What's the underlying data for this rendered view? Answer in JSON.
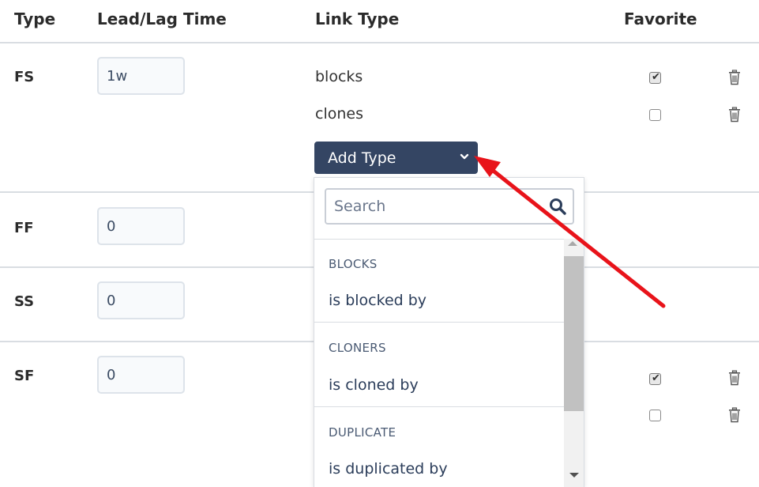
{
  "headers": {
    "type": "Type",
    "lead_lag": "Lead/Lag Time",
    "link_type": "Link Type",
    "favorite": "Favorite"
  },
  "rows": [
    {
      "type": "FS",
      "lead_lag": "1w"
    },
    {
      "type": "FF",
      "lead_lag": "0"
    },
    {
      "type": "SS",
      "lead_lag": "0"
    },
    {
      "type": "SF",
      "lead_lag": "0"
    }
  ],
  "fs_links": [
    {
      "label": "blocks",
      "favorite": true
    },
    {
      "label": "clones",
      "favorite": false
    }
  ],
  "sf_links": [
    {
      "favorite": true
    },
    {
      "favorite": false
    }
  ],
  "add_type": {
    "label": "Add Type",
    "icon": "chevron-down-icon"
  },
  "dropdown": {
    "search_placeholder": "Search",
    "search_icon": "search-icon",
    "groups": [
      {
        "heading": "BLOCKS",
        "item": "is blocked by"
      },
      {
        "heading": "CLONERS",
        "item": "is cloned by"
      },
      {
        "heading": "DUPLICATE",
        "item": "is duplicated by"
      }
    ]
  },
  "colors": {
    "button_bg": "#344563",
    "annotation_arrow": "#e8131a",
    "border": "#d9dde2"
  }
}
